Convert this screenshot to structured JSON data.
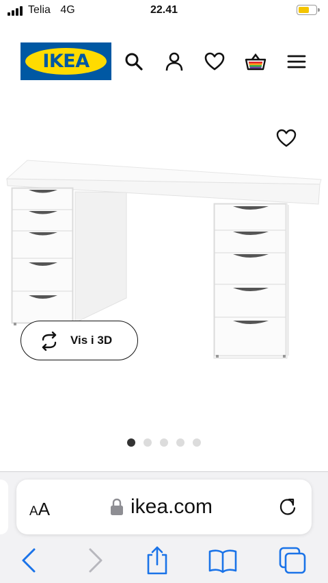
{
  "status_bar": {
    "carrier": "Telia",
    "network": "4G",
    "time": "22.41",
    "battery_color": "#f4c400"
  },
  "header": {
    "logo_text": "IKEA",
    "brand_blue": "#0058a3",
    "brand_yellow": "#ffdb00",
    "icons": [
      "search-icon",
      "user-icon",
      "heart-icon",
      "shopping-bag-icon",
      "menu-icon"
    ]
  },
  "product": {
    "favorite_icon": "heart-icon",
    "view_3d_label": "Vis i 3D",
    "carousel": {
      "total": 5,
      "active": 1
    }
  },
  "browser": {
    "text_size_label_big": "A",
    "text_size_label_small": "A",
    "url": "ikea.com",
    "accent": "#1a73e8",
    "toolbar": [
      "back-icon",
      "forward-icon",
      "share-icon",
      "bookmarks-icon",
      "tabs-icon"
    ]
  }
}
